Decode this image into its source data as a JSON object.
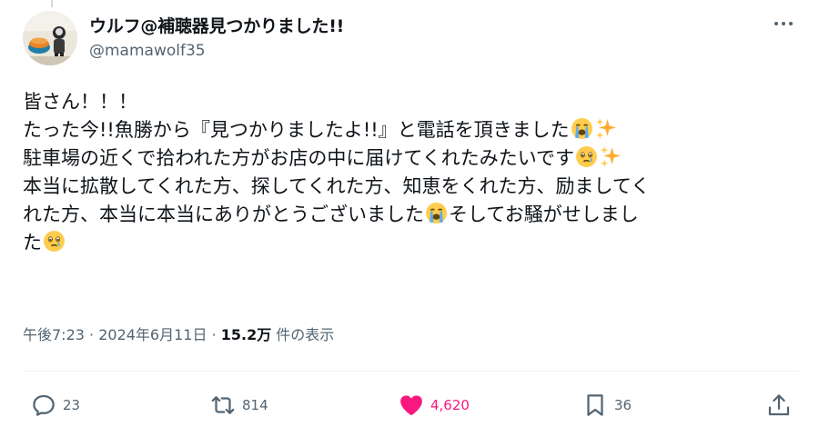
{
  "author": {
    "display_name": "ウルフ@補聴器見つかりました!!",
    "handle": "@mamawolf35"
  },
  "tweet": {
    "lines": [
      {
        "text": "皆さん！！！",
        "emojis": []
      },
      {
        "text": "たった今!!魚勝から『見つかりましたよ!!』と電話を頂きました",
        "emojis": [
          "loudly-crying-face",
          "sparkles"
        ]
      },
      {
        "text": "駐車場の近くで拾われた方がお店の中に届けてくれたみたいです",
        "emojis": [
          "face-holding-back-tears",
          "sparkles"
        ]
      },
      {
        "text": "本当に拡散してくれた方、探してくれた方、知恵をくれた方、励ましてく",
        "emojis": []
      },
      {
        "text": "れた方、本当に本当にありがとうございました",
        "emojis": [
          "loudly-crying-face"
        ],
        "after": "そしてお騒がせしまし"
      },
      {
        "text": "た",
        "emojis": [
          "face-holding-back-tears"
        ]
      }
    ]
  },
  "meta": {
    "time": "午後7:23",
    "separator": " · ",
    "date": "2024年6月11日",
    "views_count": "15.2万",
    "views_label": " 件の表示"
  },
  "actions": {
    "replies": "23",
    "retweets": "814",
    "likes": "4,620",
    "bookmarks": "36"
  },
  "colors": {
    "text": "#0f1419",
    "secondary": "#536471",
    "like": "#f91880",
    "divider": "#eff3f4"
  }
}
